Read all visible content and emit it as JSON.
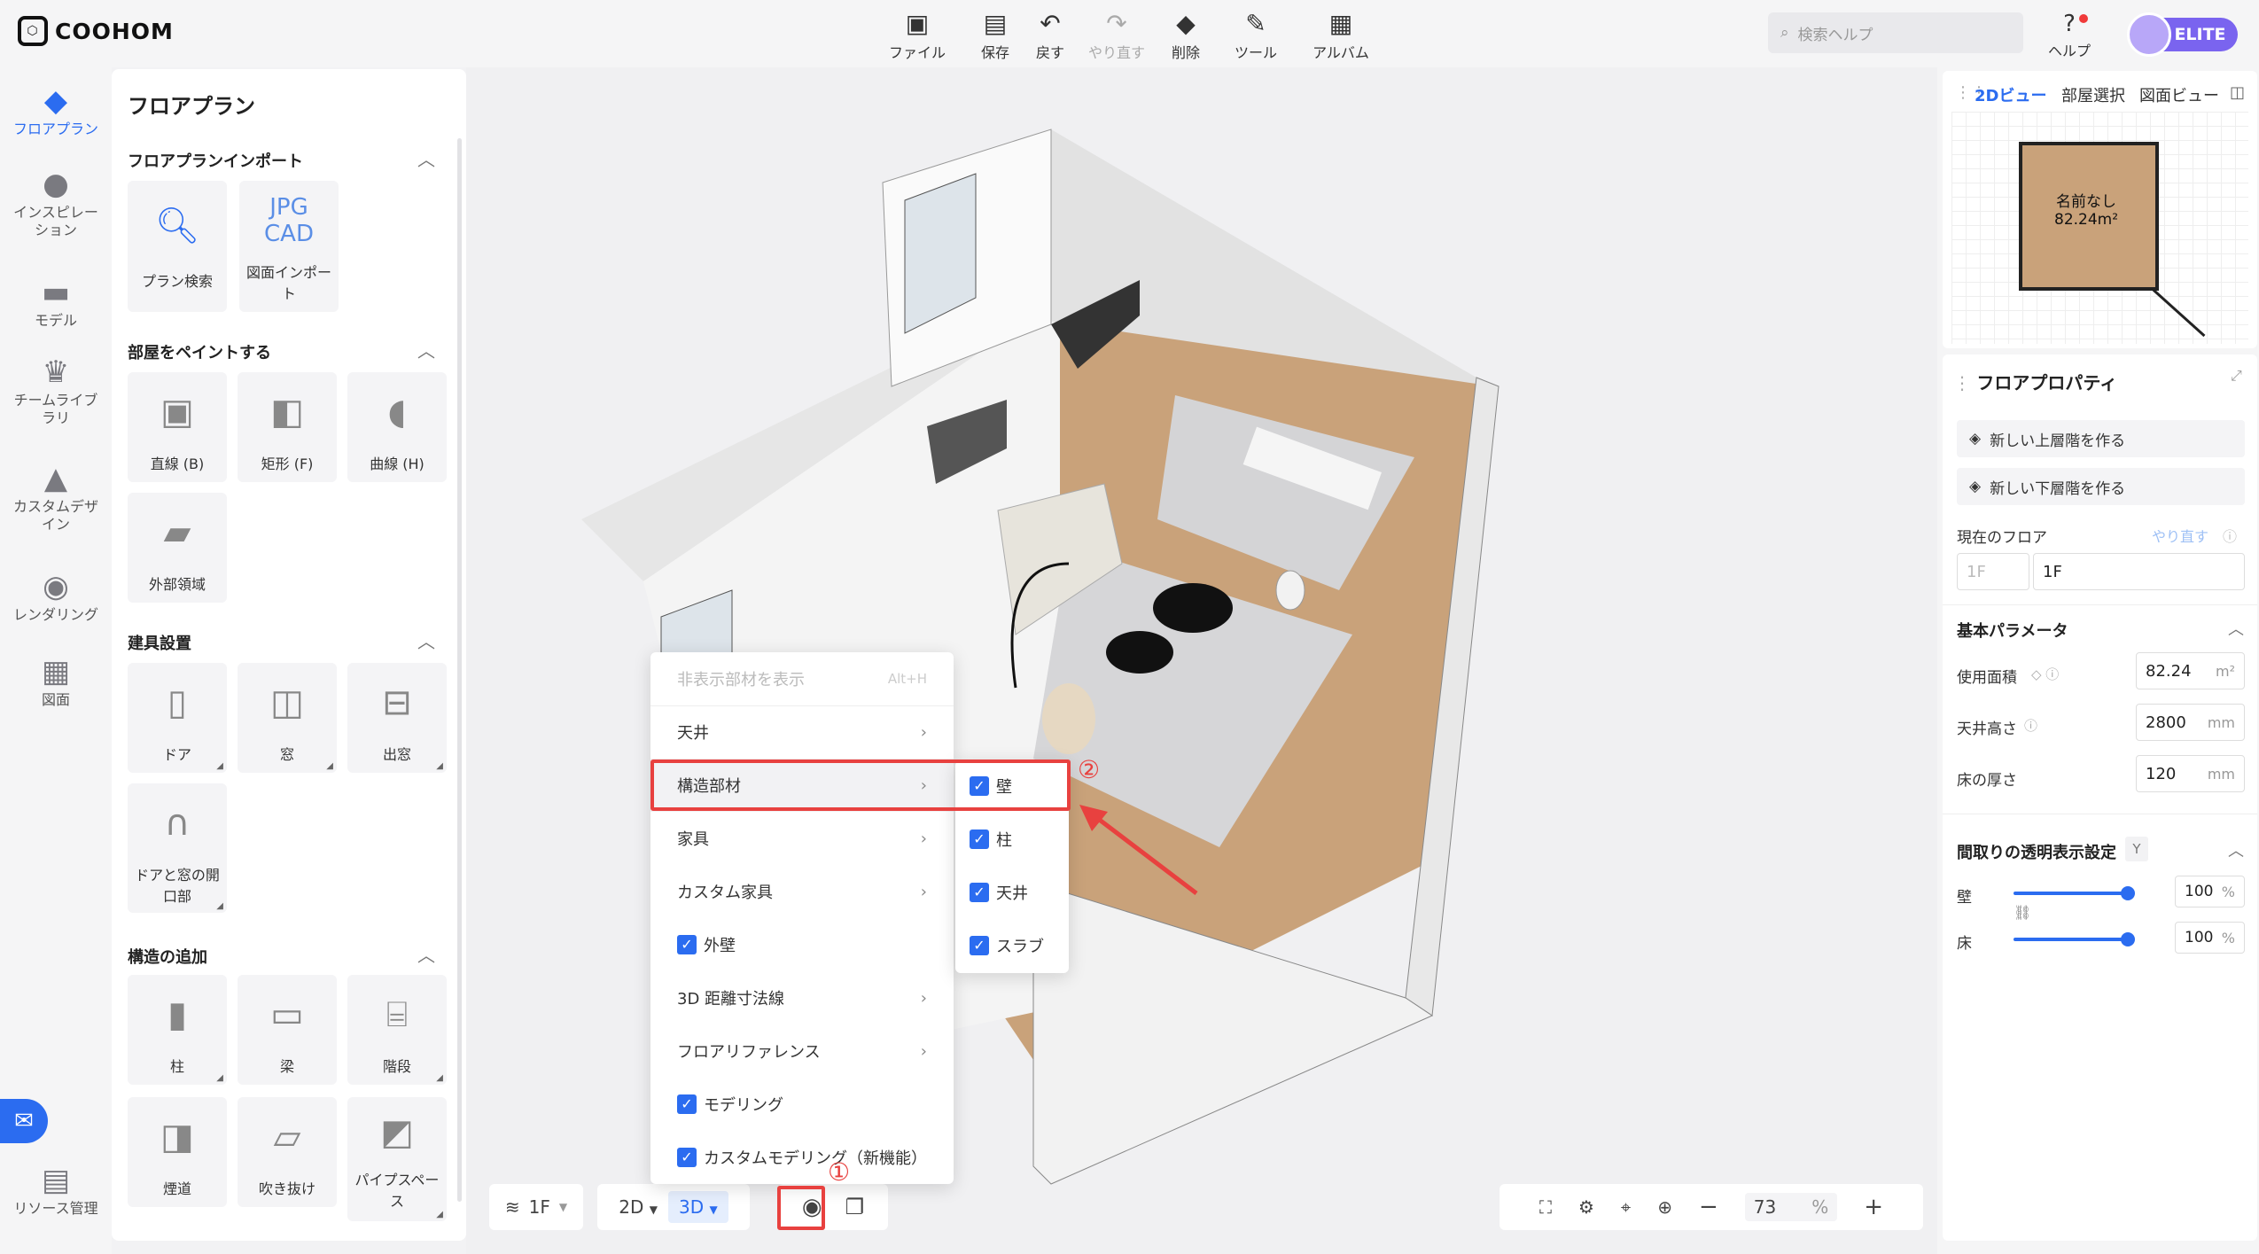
{
  "topbar": {
    "logo": "COOHOM",
    "tools": [
      {
        "label": "ファイル",
        "icon": "file-icon",
        "glyph": "▣"
      },
      {
        "label": "保存",
        "icon": "save-icon",
        "glyph": "▤"
      },
      {
        "label": "戻す",
        "icon": "undo-icon",
        "glyph": "↶"
      },
      {
        "label": "やり直す",
        "icon": "redo-icon",
        "glyph": "↷"
      },
      {
        "label": "削除",
        "icon": "eraser-icon",
        "glyph": "◆"
      },
      {
        "label": "ツール",
        "icon": "wrench-icon",
        "glyph": "✎"
      },
      {
        "label": "アルバム",
        "icon": "album-icon",
        "glyph": "▦"
      }
    ],
    "search_placeholder": "検索ヘルプ",
    "help_label": "ヘルプ",
    "badge": "ELITE"
  },
  "rail": [
    {
      "label": "フロアプラン",
      "glyph": "◆"
    },
    {
      "label": "インスピレーション",
      "glyph": "●"
    },
    {
      "label": "モデル",
      "glyph": "▬"
    },
    {
      "label": "チームライブラリ",
      "glyph": "♛"
    },
    {
      "label": "カスタムデザイン",
      "glyph": "▲"
    },
    {
      "label": "レンダリング",
      "glyph": "◉"
    },
    {
      "label": "図面",
      "glyph": "▦"
    },
    {
      "label": "リソース管理",
      "glyph": "▤"
    }
  ],
  "left_panel": {
    "title": "フロアプラン",
    "sections": [
      {
        "title": "フロアプランインポート",
        "items": [
          "プラン検索",
          "図面インポート"
        ]
      },
      {
        "title": "部屋をペイントする",
        "items": [
          "直線 (B)",
          "矩形 (F)",
          "曲線 (H)",
          "外部領域"
        ]
      },
      {
        "title": "建具設置",
        "items": [
          "ドア",
          "窓",
          "出窓",
          "ドアと窓の開口部"
        ]
      },
      {
        "title": "構造の追加",
        "items": [
          "柱",
          "梁",
          "階段",
          "煙道",
          "吹き抜け",
          "パイプスペース"
        ]
      }
    ]
  },
  "minimap": {
    "tabs": [
      "2Dビュー",
      "部屋選択",
      "図面ビュー"
    ],
    "room_name": "名前なし",
    "room_area": "82.24m²"
  },
  "props": {
    "title": "フロアプロパティ",
    "btn_up": "新しい上層階を作る",
    "btn_down": "新しい下層階を作る",
    "current_floor_label": "現在のフロア",
    "current_floor_action": "やり直す",
    "floor_prefix": "1F",
    "floor_value": "1F",
    "basic_title": "基本パラメータ",
    "area_label": "使用面積",
    "area_value": "82.24",
    "area_unit": "m²",
    "ceiling_label": "天井高さ",
    "ceiling_value": "2800",
    "ceiling_unit": "mm",
    "floor_thick_label": "床の厚さ",
    "floor_thick_value": "120",
    "floor_thick_unit": "mm",
    "transparency_title": "間取りの透明表示設定",
    "transparency_key": "Y",
    "wall_label": "壁",
    "wall_value": "100",
    "floor_label": "床",
    "floor_value2": "100",
    "pct": "%"
  },
  "bottom": {
    "floor": "1F",
    "view2d": "2D",
    "view3d": "3D",
    "zoom": "73",
    "zoom_unit": "%"
  },
  "menu": {
    "items": [
      {
        "label": "非表示部材を表示",
        "shortcut": "Alt+H",
        "type": "disabled"
      },
      {
        "label": "天井",
        "type": "sub"
      },
      {
        "label": "構造部材",
        "type": "sub"
      },
      {
        "label": "家具",
        "type": "sub"
      },
      {
        "label": "カスタム家具",
        "type": "sub"
      },
      {
        "label": "外壁",
        "type": "check"
      },
      {
        "label": "3D 距離寸法線",
        "type": "sub"
      },
      {
        "label": "フロアリファレンス",
        "type": "sub"
      },
      {
        "label": "モデリング",
        "type": "check"
      },
      {
        "label": "カスタムモデリング（新機能）",
        "type": "check"
      }
    ],
    "submenu": [
      "壁",
      "柱",
      "天井",
      "スラブ"
    ],
    "marker1": "①",
    "marker2": "②"
  },
  "colors": {
    "accent": "#2b6cf0",
    "highlight": "#e8413f",
    "floor_wood": "#c9a27a",
    "rug": "#d4d4d6"
  }
}
